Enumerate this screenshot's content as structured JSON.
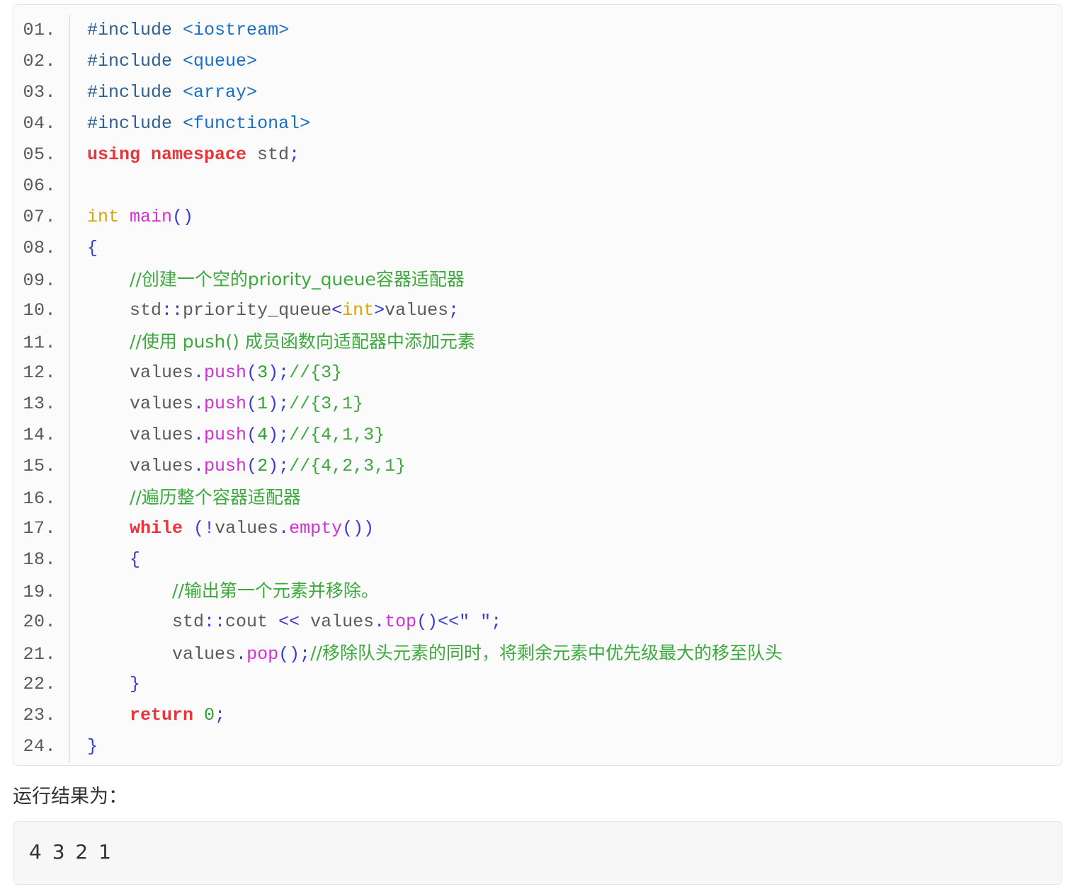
{
  "code_block": {
    "language": "cpp",
    "line_numbers": [
      "01.",
      "02.",
      "03.",
      "04.",
      "05.",
      "06.",
      "07.",
      "08.",
      "09.",
      "10.",
      "11.",
      "12.",
      "13.",
      "14.",
      "15.",
      "16.",
      "17.",
      "18.",
      "19.",
      "20.",
      "21.",
      "22.",
      "23.",
      "24."
    ],
    "lines": [
      "#include <iostream>",
      "#include <queue>",
      "#include <array>",
      "#include <functional>",
      "using namespace std;",
      "",
      "int main()",
      "{",
      "    //创建一个空的priority_queue容器适配器",
      "    std::priority_queue<int>values;",
      "    //使用 push() 成员函数向适配器中添加元素",
      "    values.push(3);//{3}",
      "    values.push(1);//{3,1}",
      "    values.push(4);//{4,1,3}",
      "    values.push(2);//{4,2,3,1}",
      "    //遍历整个容器适配器",
      "    while (!values.empty())",
      "    {",
      "        //输出第一个元素并移除。",
      "        std::cout << values.top()<<\" \";",
      "        values.pop();//移除队头元素的同时，将剩余元素中优先级最大的移至队头",
      "    }",
      "    return 0;",
      "}"
    ],
    "tokens": {
      "l1": [
        [
          "#include",
          "t-pre"
        ],
        [
          " ",
          "t-plain"
        ],
        [
          "<iostream>",
          "t-hdr"
        ]
      ],
      "l2": [
        [
          "#include",
          "t-pre"
        ],
        [
          " ",
          "t-plain"
        ],
        [
          "<queue>",
          "t-hdr"
        ]
      ],
      "l3": [
        [
          "#include",
          "t-pre"
        ],
        [
          " ",
          "t-plain"
        ],
        [
          "<array>",
          "t-hdr"
        ]
      ],
      "l4": [
        [
          "#include",
          "t-pre"
        ],
        [
          " ",
          "t-plain"
        ],
        [
          "<functional>",
          "t-hdr"
        ]
      ],
      "l5": [
        [
          "using namespace",
          "t-kw"
        ],
        [
          " std",
          "t-plain"
        ],
        [
          ";",
          "t-punc"
        ]
      ],
      "l6": [],
      "l7": [
        [
          "int",
          "t-type"
        ],
        [
          " ",
          "t-plain"
        ],
        [
          "main",
          "t-fn"
        ],
        [
          "()",
          "t-punc"
        ]
      ],
      "l8": [
        [
          "{",
          "t-brace"
        ]
      ],
      "l9": [
        [
          "    ",
          "t-plain"
        ],
        [
          "//创建一个空的priority_queue容器适配器",
          "t-cmt"
        ]
      ],
      "l10": [
        [
          "    std",
          "t-plain"
        ],
        [
          "::",
          "t-punc"
        ],
        [
          "priority_queue",
          "t-plain"
        ],
        [
          "<",
          "t-punc"
        ],
        [
          "int",
          "t-type"
        ],
        [
          ">",
          "t-punc"
        ],
        [
          "values",
          "t-plain"
        ],
        [
          ";",
          "t-punc"
        ]
      ],
      "l11": [
        [
          "    ",
          "t-plain"
        ],
        [
          "//使用 push() 成员函数向适配器中添加元素",
          "t-cmt"
        ]
      ],
      "l12": [
        [
          "    values",
          "t-plain"
        ],
        [
          ".",
          "t-punc"
        ],
        [
          "push",
          "t-fn"
        ],
        [
          "(",
          "t-punc"
        ],
        [
          "3",
          "t-num"
        ],
        [
          ")",
          "t-punc"
        ],
        [
          ";",
          "t-punc"
        ],
        [
          "//{3}",
          "t-cmt"
        ]
      ],
      "l13": [
        [
          "    values",
          "t-plain"
        ],
        [
          ".",
          "t-punc"
        ],
        [
          "push",
          "t-fn"
        ],
        [
          "(",
          "t-punc"
        ],
        [
          "1",
          "t-num"
        ],
        [
          ")",
          "t-punc"
        ],
        [
          ";",
          "t-punc"
        ],
        [
          "//{3,1}",
          "t-cmt"
        ]
      ],
      "l14": [
        [
          "    values",
          "t-plain"
        ],
        [
          ".",
          "t-punc"
        ],
        [
          "push",
          "t-fn"
        ],
        [
          "(",
          "t-punc"
        ],
        [
          "4",
          "t-num"
        ],
        [
          ")",
          "t-punc"
        ],
        [
          ";",
          "t-punc"
        ],
        [
          "//{4,1,3}",
          "t-cmt"
        ]
      ],
      "l15": [
        [
          "    values",
          "t-plain"
        ],
        [
          ".",
          "t-punc"
        ],
        [
          "push",
          "t-fn"
        ],
        [
          "(",
          "t-punc"
        ],
        [
          "2",
          "t-num"
        ],
        [
          ")",
          "t-punc"
        ],
        [
          ";",
          "t-punc"
        ],
        [
          "//{4,2,3,1}",
          "t-cmt"
        ]
      ],
      "l16": [
        [
          "    ",
          "t-plain"
        ],
        [
          "//遍历整个容器适配器",
          "t-cmt"
        ]
      ],
      "l17": [
        [
          "    ",
          "t-plain"
        ],
        [
          "while",
          "t-kw"
        ],
        [
          " ",
          "t-plain"
        ],
        [
          "(!",
          "t-punc"
        ],
        [
          "values",
          "t-plain"
        ],
        [
          ".",
          "t-punc"
        ],
        [
          "empty",
          "t-fn"
        ],
        [
          "())",
          "t-punc"
        ]
      ],
      "l18": [
        [
          "    ",
          "t-plain"
        ],
        [
          "{",
          "t-brace"
        ]
      ],
      "l19": [
        [
          "        ",
          "t-plain"
        ],
        [
          "//输出第一个元素并移除。",
          "t-cmt"
        ]
      ],
      "l20": [
        [
          "        std",
          "t-plain"
        ],
        [
          "::",
          "t-punc"
        ],
        [
          "cout ",
          "t-plain"
        ],
        [
          "<<",
          "t-punc"
        ],
        [
          " values",
          "t-plain"
        ],
        [
          ".",
          "t-punc"
        ],
        [
          "top",
          "t-fn"
        ],
        [
          "()",
          "t-punc"
        ],
        [
          "<<",
          "t-punc"
        ],
        [
          "\" \"",
          "t-punc"
        ],
        [
          ";",
          "t-punc"
        ]
      ],
      "l21": [
        [
          "        values",
          "t-plain"
        ],
        [
          ".",
          "t-punc"
        ],
        [
          "pop",
          "t-fn"
        ],
        [
          "()",
          "t-punc"
        ],
        [
          ";",
          "t-punc"
        ],
        [
          "//移除队头元素的同时，将剩余元素中优先级最大的移至队头",
          "t-cmt"
        ]
      ],
      "l22": [
        [
          "    ",
          "t-plain"
        ],
        [
          "}",
          "t-brace"
        ]
      ],
      "l23": [
        [
          "    ",
          "t-plain"
        ],
        [
          "return",
          "t-kw"
        ],
        [
          " ",
          "t-plain"
        ],
        [
          "0",
          "t-num"
        ],
        [
          ";",
          "t-punc"
        ]
      ],
      "l24": [
        [
          "}",
          "t-brace"
        ]
      ]
    }
  },
  "result": {
    "label": "运行结果为：",
    "output": "4 3 2 1"
  },
  "colors": {
    "preprocessor": "#30608f",
    "header": "#1a6fc4",
    "keyword": "#e8353c",
    "punctuation": "#3a3ad4",
    "type": "#d9a406",
    "function": "#d330d3",
    "number": "#2aa32a",
    "comment": "#3da83d",
    "plain_text": "#5b5b5b",
    "line_number": "#555a60",
    "code_background": "#fbfbfc",
    "code_border": "#e6e6e6",
    "output_background": "#f7f7f8"
  }
}
